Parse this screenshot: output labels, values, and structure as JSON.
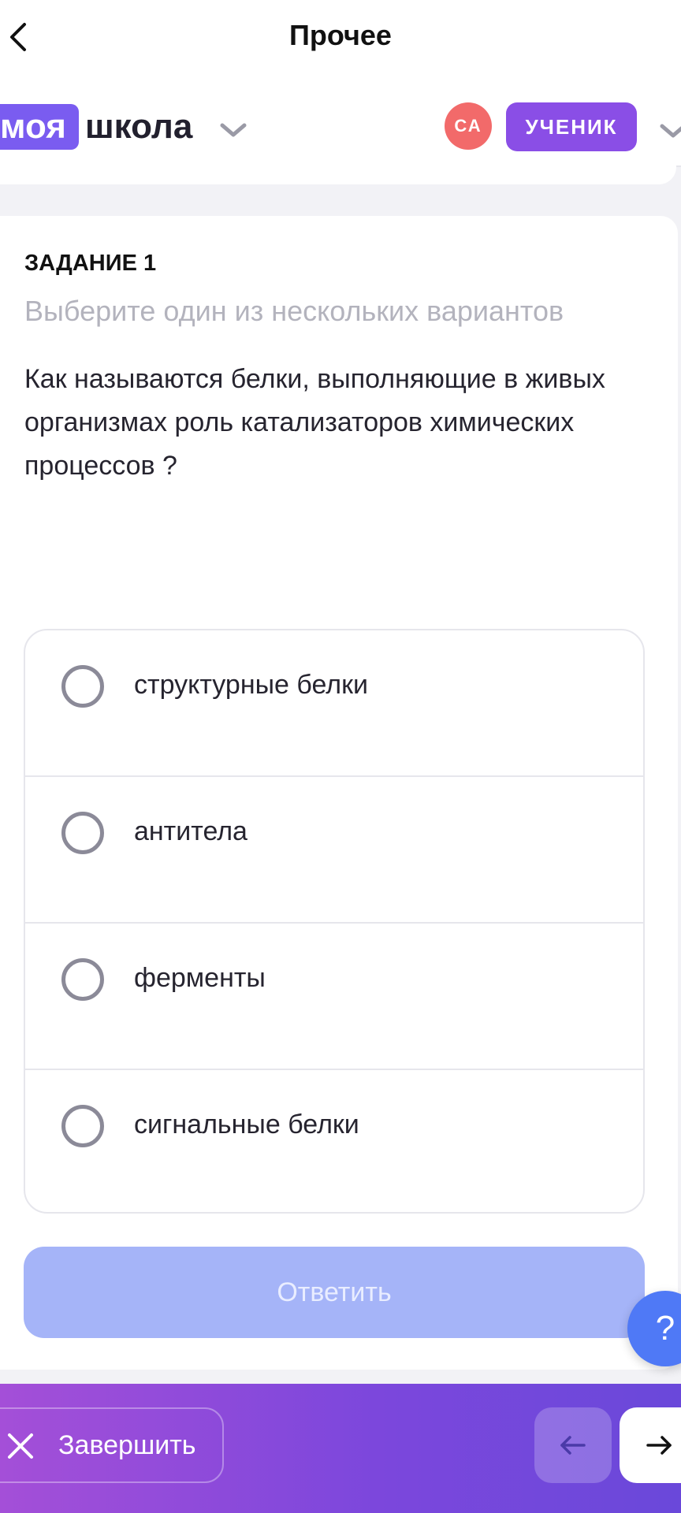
{
  "nav": {
    "title": "Прочее"
  },
  "header": {
    "logo_badge": "моя",
    "logo_text": "школа",
    "avatar_initials": "СА",
    "role": "УЧЕНИК"
  },
  "task": {
    "label": "ЗАДАНИЕ 1",
    "hint": "Выберите один из нескольких вариантов",
    "question": "Как называются белки, выполняющие в живых организмах роль катализаторов химических процессов ?",
    "options": [
      {
        "label": "структурные белки",
        "selected": false
      },
      {
        "label": "антитела",
        "selected": false
      },
      {
        "label": "ферменты",
        "selected": false
      },
      {
        "label": "сигнальные белки",
        "selected": false
      }
    ],
    "answer_label": "Ответить"
  },
  "help": {
    "label": "?"
  },
  "bottom": {
    "finish_label": "Завершить"
  },
  "icons": {
    "back": "chevron-left-icon",
    "school_dropdown": "chevron-down-icon",
    "role_dropdown": "chevron-down-icon",
    "finish": "close-icon",
    "prev": "arrow-left-icon",
    "next": "arrow-right-icon"
  },
  "colors": {
    "brand": "#7a5cf0",
    "role_badge": "#8a4ee6",
    "avatar": "#f26a6a",
    "answer_button_disabled": "#a5b4f8",
    "help_button": "#4f79f6",
    "bottom_gradient_start": "#a44fd8",
    "bottom_gradient_end": "#6a48da"
  }
}
